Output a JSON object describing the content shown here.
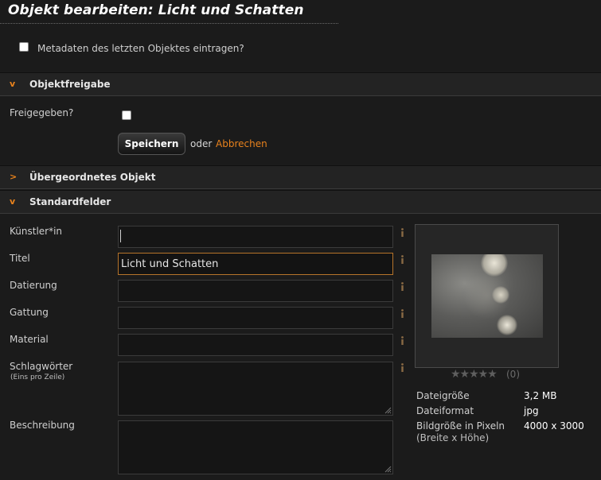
{
  "page": {
    "title": "Objekt bearbeiten: Licht und Schatten"
  },
  "metadata_option": {
    "label": "Metadaten des letzten Objektes eintragen?",
    "checked": false
  },
  "sections": {
    "objektfreigabe": {
      "label": "Objektfreigabe",
      "chevron": "v",
      "expanded": true
    },
    "uebergeordnet": {
      "label": "Übergeordnetes Objekt",
      "chevron": ">",
      "expanded": false
    },
    "standardfelder": {
      "label": "Standardfelder",
      "chevron": "v",
      "expanded": true
    }
  },
  "freigabe": {
    "label": "Freigegeben?",
    "checked": false,
    "save_label": "Speichern",
    "or_text": "oder",
    "cancel_label": "Abbrechen"
  },
  "fields": {
    "kuenstler": {
      "label": "Künstler*in",
      "value": ""
    },
    "titel": {
      "label": "Titel",
      "value": "Licht und Schatten"
    },
    "datierung": {
      "label": "Datierung",
      "value": ""
    },
    "gattung": {
      "label": "Gattung",
      "value": ""
    },
    "material": {
      "label": "Material",
      "value": ""
    },
    "schlagwoerter": {
      "label": "Schlagwörter",
      "hint": "(Eins pro Zeile)",
      "value": ""
    },
    "beschreibung": {
      "label": "Beschreibung",
      "value": ""
    }
  },
  "preview": {
    "rating_stars": "★★★★★",
    "rating_count": "(0)",
    "file_size_label": "Dateigröße",
    "file_size": "3,2 MB",
    "file_format_label": "Dateiformat",
    "file_format": "jpg",
    "pixel_size_label": "Bildgröße in Pixeln",
    "pixel_size_hint": "(Breite x Höhe)",
    "pixel_size": "4000 x 3000"
  },
  "colors": {
    "accent": "#e8821c",
    "background": "#1b1b1b",
    "section_bar": "#232323",
    "field_bg": "#151515"
  },
  "icons": {
    "info": "info-icon",
    "resize": "resize-grip-icon"
  }
}
